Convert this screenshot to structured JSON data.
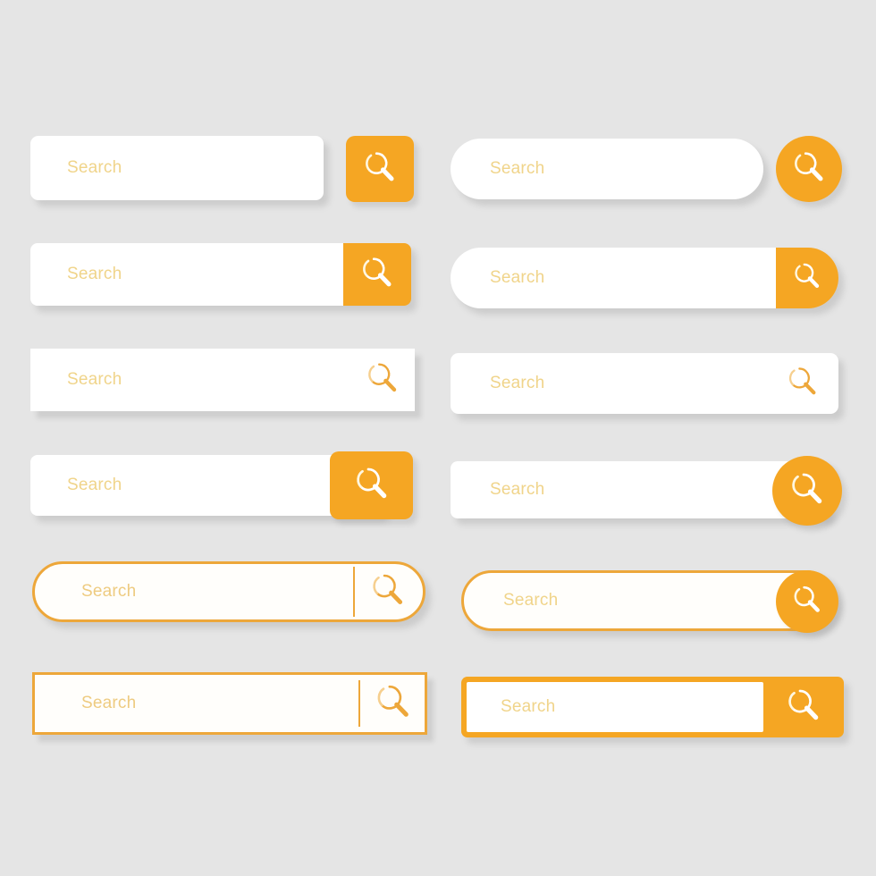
{
  "page": {
    "title": "Search Bar UI Kit",
    "background_color": "#e5e5e5",
    "accent_color": "#f5a623",
    "accent_border_color": "#eda73a",
    "placeholder_color": "#f0d48a",
    "field_color": "#ffffff"
  },
  "icons": {
    "search": "search-icon",
    "magnifier_glyph": "magnifying-glass"
  },
  "search_bars": [
    {
      "id": "bar-1",
      "style": "rounded-rect-field-with-detached-square-button",
      "placeholder": "Search",
      "value": "",
      "button_icon": "search-icon",
      "button_icon_color": "#ffffff",
      "button_color": "#f5a623"
    },
    {
      "id": "bar-2",
      "style": "pill-field-with-detached-circle-button",
      "placeholder": "Search",
      "value": "",
      "button_icon": "search-icon",
      "button_icon_color": "#ffffff",
      "button_color": "#f5a623"
    },
    {
      "id": "bar-3",
      "style": "rounded-rect-field-with-attached-square-button",
      "placeholder": "Search",
      "value": "",
      "button_icon": "search-icon",
      "button_icon_color": "#ffffff",
      "button_color": "#f5a623"
    },
    {
      "id": "bar-4",
      "style": "pill-field-with-attached-pill-button",
      "placeholder": "Search",
      "value": "",
      "button_icon": "search-icon",
      "button_icon_color": "#ffffff",
      "button_color": "#f5a623"
    },
    {
      "id": "bar-5",
      "style": "square-field-with-inline-icon",
      "placeholder": "Search",
      "value": "",
      "button_icon": "search-icon",
      "button_icon_color": "#eda73a",
      "button_color": "transparent"
    },
    {
      "id": "bar-6",
      "style": "rounded-field-with-inline-icon",
      "placeholder": "Search",
      "value": "",
      "button_icon": "search-icon",
      "button_icon_color": "#eda73a",
      "button_color": "transparent"
    },
    {
      "id": "bar-7",
      "style": "rounded-rect-field-with-overlapping-square-button",
      "placeholder": "Search",
      "value": "",
      "button_icon": "search-icon",
      "button_icon_color": "#ffffff",
      "button_color": "#f5a623"
    },
    {
      "id": "bar-8",
      "style": "rounded-rect-field-with-overlapping-circle-button",
      "placeholder": "Search",
      "value": "",
      "button_icon": "search-icon",
      "button_icon_color": "#ffffff",
      "button_color": "#f5a623"
    },
    {
      "id": "bar-9",
      "style": "outlined-pill-field-with-divider-and-icon",
      "placeholder": "Search",
      "value": "",
      "button_icon": "search-icon",
      "button_icon_color": "#eda73a",
      "button_color": "transparent",
      "has_divider": true
    },
    {
      "id": "bar-10",
      "style": "outlined-pill-field-with-overlapping-circle-button",
      "placeholder": "Search",
      "value": "",
      "button_icon": "search-icon",
      "button_icon_color": "#ffffff",
      "button_color": "#f5a623"
    },
    {
      "id": "bar-11",
      "style": "outlined-rect-field-with-divider-and-icon",
      "placeholder": "Search",
      "value": "",
      "button_icon": "search-icon",
      "button_icon_color": "#eda73a",
      "button_color": "transparent",
      "has_divider": true
    },
    {
      "id": "bar-12",
      "style": "orange-container-with-inset-field-and-button",
      "placeholder": "Search",
      "value": "",
      "button_icon": "search-icon",
      "button_icon_color": "#ffffff",
      "button_color": "#f5a623"
    }
  ]
}
